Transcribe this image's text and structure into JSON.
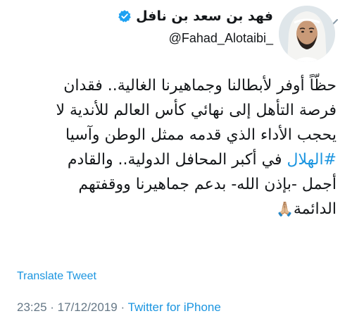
{
  "author": {
    "name": "فهد بن سعد بن نافل",
    "handle": "@Fahad_Alotaibi_",
    "verified": true
  },
  "tweet": {
    "line1": "حظّاً أوفر لأبطالنا وجماهيرنا الغالية.. فقدان",
    "line2": "فرصة التأهل إلى نهائي كأس العالم للأندية لا",
    "line3": "يحجب الأداء الذي قدمه ممثل الوطن وآسيا",
    "line4_hashtag": "#الهلال",
    "line4_rest": " في أكبر المحافل الدولية.. والقادم",
    "line5": "أجمل -بإذن الله- بدعم جماهيرنا ووقفتهم",
    "line6": "الدائمة",
    "line6_emoji": "🙏🏼"
  },
  "translate_label": "Translate Tweet",
  "meta": {
    "time": "23:25",
    "separator": " · ",
    "date": "17/12/2019",
    "source": "Twitter for iPhone"
  },
  "colors": {
    "link": "#1b95e0",
    "muted": "#657786",
    "text": "#14171a"
  },
  "icons": {
    "menu": "chevron-down-icon",
    "verified": "verified-badge-icon",
    "emoji": "folded-hands"
  }
}
